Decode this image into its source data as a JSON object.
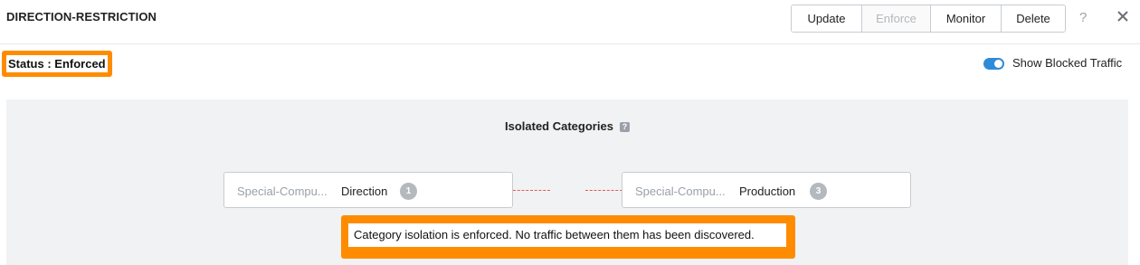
{
  "header": {
    "title": "DIRECTION-RESTRICTION",
    "buttons": [
      {
        "label": "Update",
        "enabled": true
      },
      {
        "label": "Enforce",
        "enabled": false
      },
      {
        "label": "Monitor",
        "enabled": true
      },
      {
        "label": "Delete",
        "enabled": true
      }
    ],
    "help_symbol": "?",
    "close_icon": "close-icon"
  },
  "status": {
    "text": "Status : Enforced"
  },
  "toggle": {
    "label": "Show Blocked Traffic",
    "on": true,
    "color": "#2f8bd8"
  },
  "panel": {
    "title": "Isolated Categories",
    "help_symbol": "?",
    "categories": [
      {
        "key": "Special-Compu...",
        "value": "Direction",
        "count": "1"
      },
      {
        "key": "Special-Compu...",
        "value": "Production",
        "count": "3"
      }
    ],
    "message": "Category isolation is enforced. No traffic between them has been discovered."
  },
  "colors": {
    "highlight": "#ff8c00",
    "accent": "#2f8bd8",
    "dash": "#e05a5a"
  }
}
